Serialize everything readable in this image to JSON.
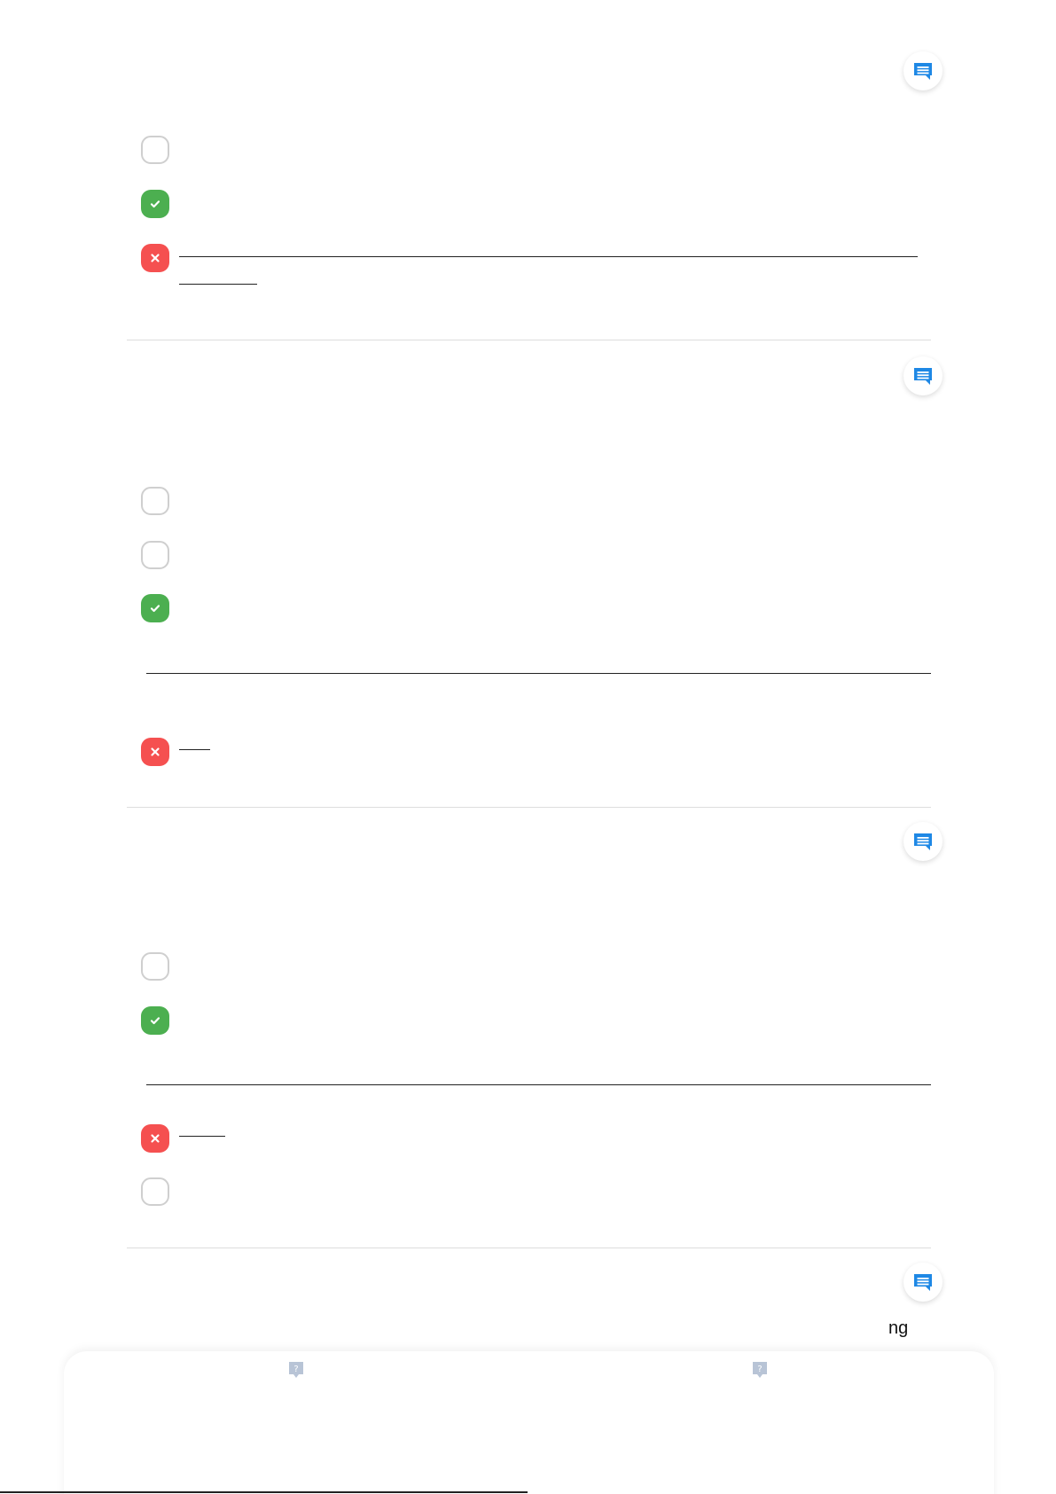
{
  "questions": [
    {
      "options": [
        {
          "state": "empty",
          "label": ""
        },
        {
          "state": "correct",
          "label": ""
        },
        {
          "state": "wrong",
          "label": ""
        }
      ]
    },
    {
      "options": [
        {
          "state": "empty",
          "label": ""
        },
        {
          "state": "empty",
          "label": ""
        },
        {
          "state": "correct",
          "label": ""
        },
        {
          "state": "wrong",
          "label": ""
        }
      ]
    },
    {
      "options": [
        {
          "state": "empty",
          "label": ""
        },
        {
          "state": "correct",
          "label": ""
        },
        {
          "state": "wrong",
          "label": ""
        },
        {
          "state": "empty",
          "label": ""
        }
      ]
    },
    {
      "options": []
    }
  ],
  "partial_text": "ng",
  "icons": {
    "comment": "comment-icon",
    "check": "check-icon",
    "cross": "close-icon",
    "help": "help-icon"
  },
  "colors": {
    "correct": "#4caf50",
    "wrong": "#f55050",
    "empty_border": "#cfcfcf",
    "comment_icon": "#1e88e5",
    "help_icon": "#b8c4d6"
  }
}
